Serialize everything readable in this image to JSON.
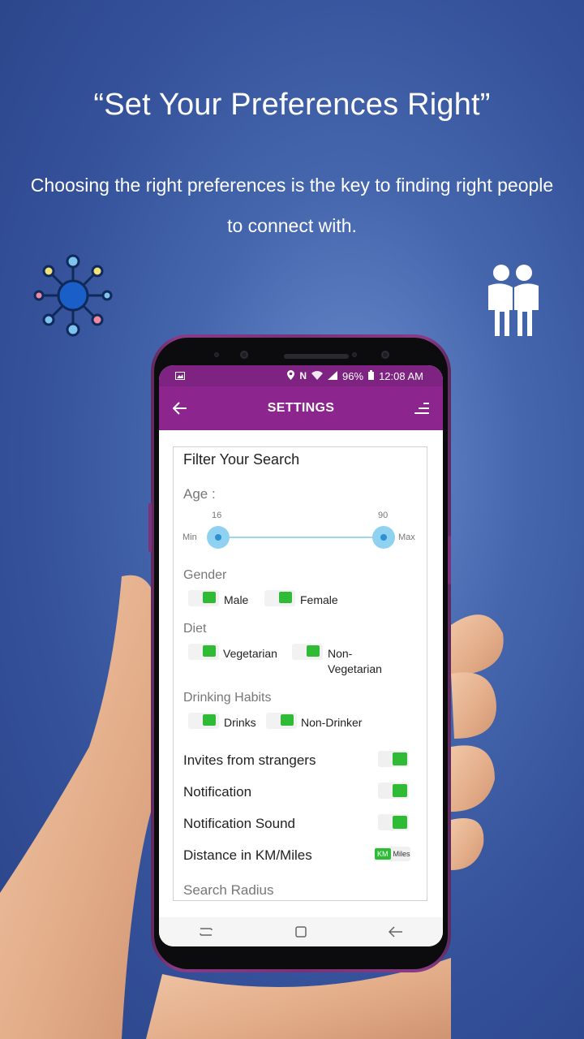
{
  "headline": "“Set Your Preferences Right”",
  "subline": "Choosing the right preferences is the key to finding right people to connect with.",
  "icons": {
    "network": "network-icon",
    "people": "people-icon"
  },
  "statusbar": {
    "battery": "96%",
    "time": "12:08 AM"
  },
  "appbar": {
    "title": "SETTINGS"
  },
  "filter": {
    "title": "Filter Your Search",
    "age_label": "Age :",
    "age_min": "16",
    "age_max": "90",
    "min_label": "Min",
    "max_label": "Max",
    "gender_label": "Gender",
    "gender_options": [
      "Male",
      "Female"
    ],
    "diet_label": "Diet",
    "diet_options": [
      "Vegetarian",
      "Non-Vegetarian"
    ],
    "drinking_label": "Drinking Habits",
    "drinking_options": [
      "Drinks",
      "Non-Drinker"
    ],
    "invites_label": "Invites from strangers",
    "notification_label": "Notification",
    "notification_sound_label": "Notification Sound",
    "distance_label": "Distance in KM/Miles",
    "unit_km": "KM",
    "unit_miles": "Miles",
    "search_radius_label": "Search Radius"
  },
  "colors": {
    "appbar": "#8c268e",
    "accent_green": "#2fbb35",
    "slider": "#8fd1f0"
  }
}
